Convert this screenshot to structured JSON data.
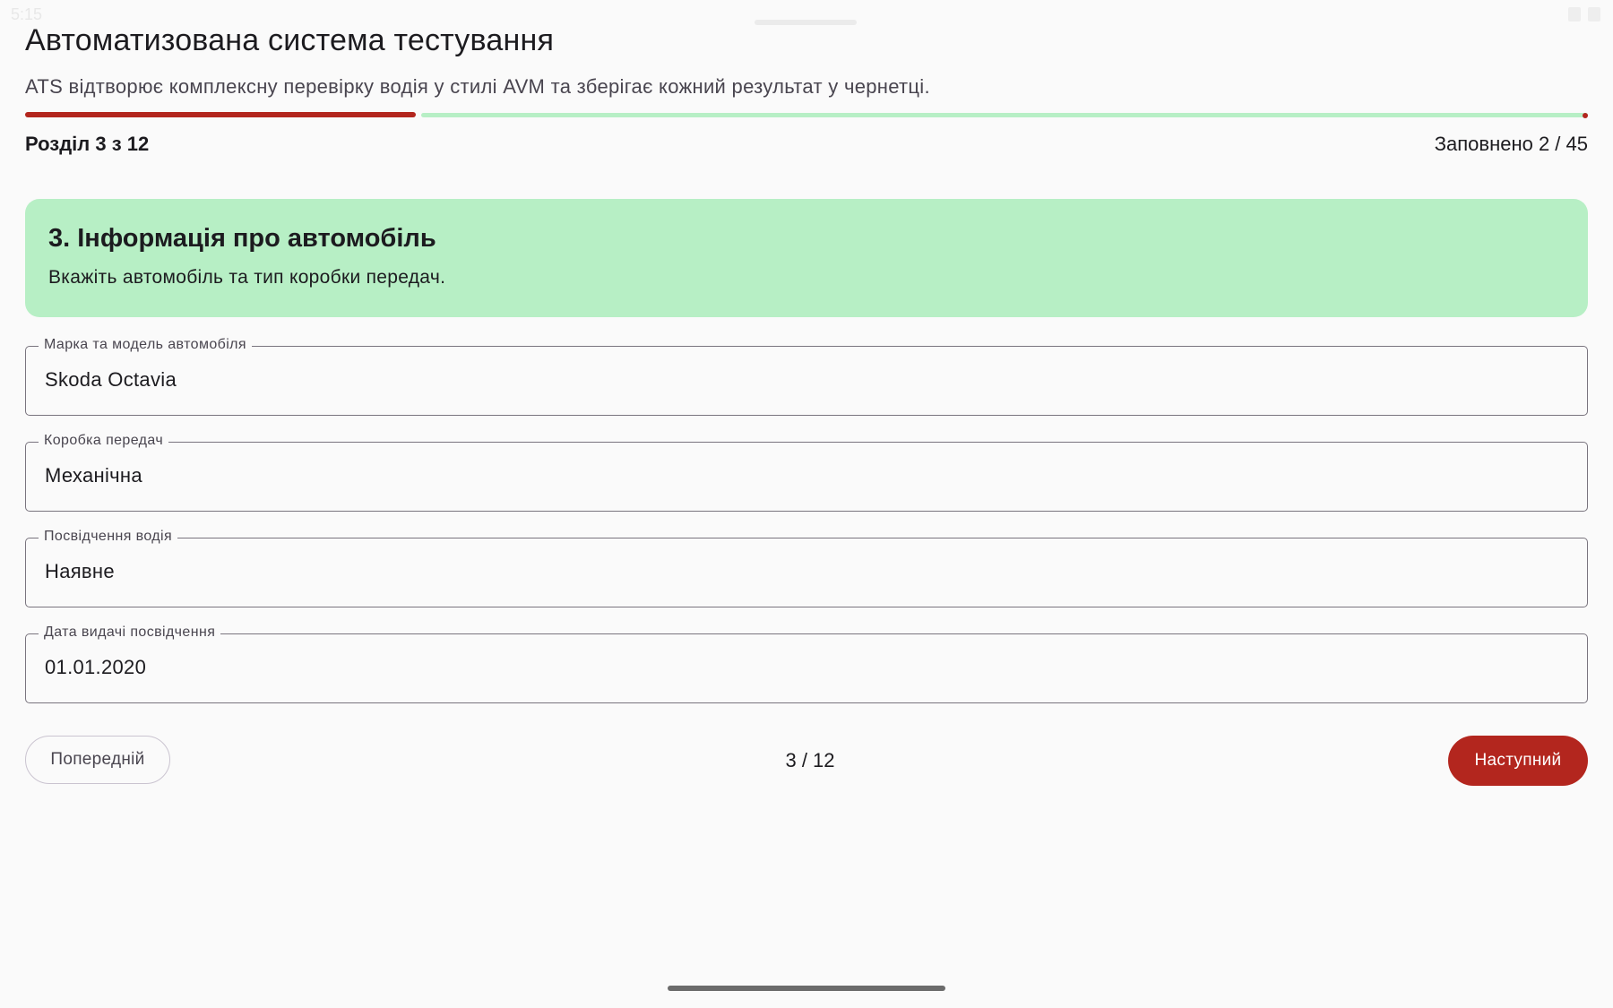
{
  "status_bar": {
    "time": "5:15"
  },
  "header": {
    "title": "Автоматизована система тестування",
    "subtitle": "ATS відтворює комплексну перевірку водія у стилі AVM та зберігає кожний результат у чернетці."
  },
  "progress": {
    "fraction": 0.25,
    "section_label": "Розділ 3 з 12",
    "filled_label": "Заповнено 2 / 45"
  },
  "section": {
    "title": "3. Інформація про автомобіль",
    "description": "Вкажіть автомобіль та тип коробки передач."
  },
  "fields": [
    {
      "label": "Марка та модель автомобіля",
      "value": "Skoda Octavia"
    },
    {
      "label": "Коробка передач",
      "value": "Механічна"
    },
    {
      "label": "Посвідчення водія",
      "value": "Наявне"
    },
    {
      "label": "Дата видачі посвідчення",
      "value": "01.01.2020"
    }
  ],
  "navigation": {
    "prev_label": "Попередній",
    "page_indicator": "3 / 12",
    "next_label": "Наступний"
  },
  "colors": {
    "accent": "#b3261e",
    "section_bg": "#b7efc5",
    "background": "#fafafa"
  }
}
